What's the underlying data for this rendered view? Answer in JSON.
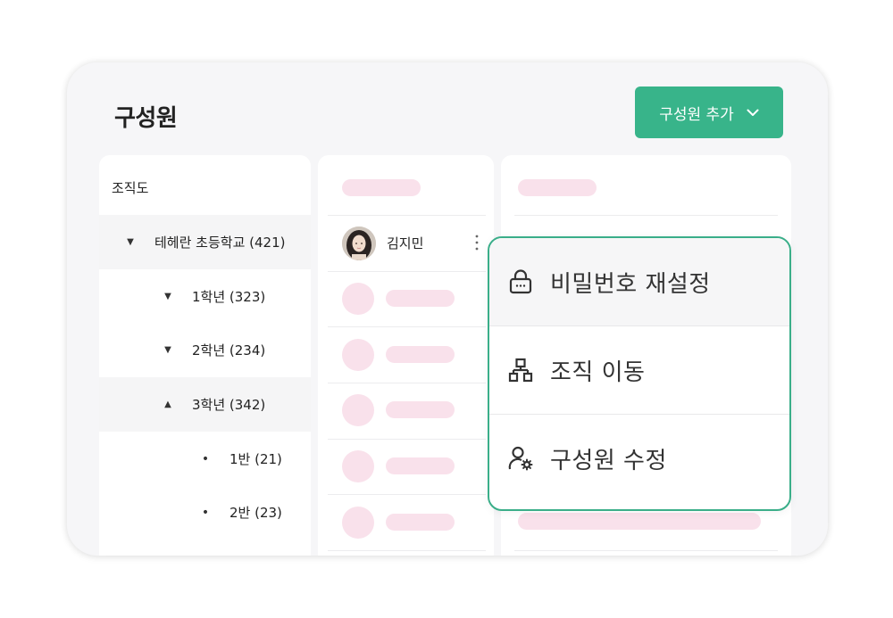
{
  "page_title": "구성원",
  "add_button": {
    "label": "구성원 추가",
    "icon": "chevron-down-icon"
  },
  "org_panel": {
    "header": "조직도",
    "tree": [
      {
        "label": "테헤란 초등학교 (421)",
        "marker": "▼",
        "state": "expanded"
      },
      {
        "label": "1학년 (323)",
        "marker": "▼",
        "state": "expanded"
      },
      {
        "label": "2학년 (234)",
        "marker": "▼",
        "state": "expanded"
      },
      {
        "label": "3학년 (342)",
        "marker": "▲",
        "state": "collapsed"
      },
      {
        "label": "1반 (21)",
        "marker": "•",
        "state": "leaf"
      },
      {
        "label": "2반 (23)",
        "marker": "•",
        "state": "leaf"
      }
    ]
  },
  "members_panel": {
    "members": [
      {
        "name": "김지민",
        "avatar": "avatar-photo"
      }
    ]
  },
  "context_menu": {
    "items": [
      {
        "label": "비밀번호 재설정",
        "icon": "lock-icon"
      },
      {
        "label": "조직 이동",
        "icon": "org-chart-icon"
      },
      {
        "label": "구성원 수정",
        "icon": "user-settings-icon"
      }
    ]
  },
  "colors": {
    "accent": "#38b48a",
    "menu_border": "#3aae89",
    "skeleton": "#f9e1eb",
    "card_background": "#f6f6f8"
  }
}
